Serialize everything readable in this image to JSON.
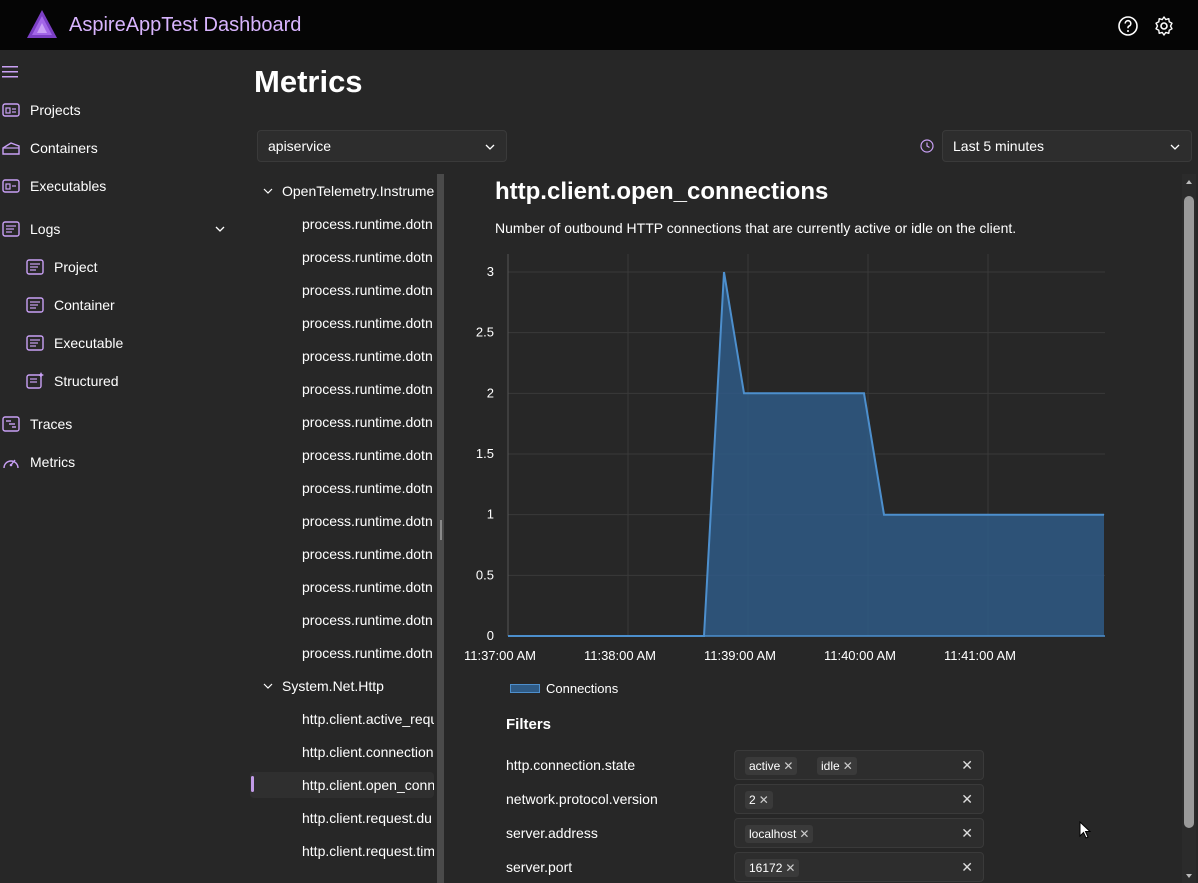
{
  "app": {
    "title": "AspireAppTest Dashboard",
    "accent": "#a366e8"
  },
  "topbar_icons": [
    "help-icon",
    "settings-icon"
  ],
  "sidebar": {
    "items": [
      {
        "label": "Projects",
        "icon": "projects-icon"
      },
      {
        "label": "Containers",
        "icon": "containers-icon"
      },
      {
        "label": "Executables",
        "icon": "executables-icon"
      },
      {
        "label": "Logs",
        "icon": "logs-icon"
      },
      {
        "label": "Project",
        "icon": "log-project-icon"
      },
      {
        "label": "Container",
        "icon": "log-container-icon"
      },
      {
        "label": "Executable",
        "icon": "log-executable-icon"
      },
      {
        "label": "Structured",
        "icon": "log-structured-icon"
      },
      {
        "label": "Traces",
        "icon": "traces-icon"
      },
      {
        "label": "Metrics",
        "icon": "metrics-icon"
      }
    ]
  },
  "page": {
    "title": "Metrics",
    "resource_select": "apiservice",
    "time_select": "Last 5 minutes"
  },
  "tree": {
    "groups": [
      {
        "name": "OpenTelemetry.Instrume",
        "items": [
          "process.runtime.dotn",
          "process.runtime.dotn",
          "process.runtime.dotn",
          "process.runtime.dotn",
          "process.runtime.dotn",
          "process.runtime.dotn",
          "process.runtime.dotn",
          "process.runtime.dotn",
          "process.runtime.dotn",
          "process.runtime.dotn",
          "process.runtime.dotn",
          "process.runtime.dotn",
          "process.runtime.dotn",
          "process.runtime.dotn"
        ]
      },
      {
        "name": "System.Net.Http",
        "items": [
          "http.client.active_requ",
          "http.client.connection",
          "http.client.open_conn",
          "http.client.request.du",
          "http.client.request.tim"
        ]
      }
    ]
  },
  "metric": {
    "title": "http.client.open_connections",
    "description": "Number of outbound HTTP connections that are currently active or idle on the client."
  },
  "chart_data": {
    "type": "area",
    "x": [
      "11:37:00 AM",
      "11:38:00 AM",
      "11:38:38 AM",
      "11:38:48 AM",
      "11:38:58 AM",
      "11:39:58 AM",
      "11:40:08 AM",
      "11:41:58 AM"
    ],
    "x_ticks": [
      "11:37:00 AM",
      "11:38:00 AM",
      "11:39:00 AM",
      "11:40:00 AM",
      "11:41:00 AM"
    ],
    "series": [
      {
        "name": "Connections",
        "values": [
          0,
          0,
          0,
          3,
          2,
          2,
          1,
          1
        ],
        "color": "#2f5b86"
      }
    ],
    "y_ticks": [
      "0",
      "0.5",
      "1",
      "1.5",
      "2",
      "2.5",
      "3"
    ],
    "ylim": [
      0,
      3
    ],
    "grid": true,
    "legend": "bottom-left"
  },
  "filters": {
    "title": "Filters",
    "rows": [
      {
        "label": "http.connection.state",
        "chips": [
          "active",
          "idle"
        ]
      },
      {
        "label": "network.protocol.version",
        "chips": [
          "2"
        ]
      },
      {
        "label": "server.address",
        "chips": [
          "localhost"
        ]
      },
      {
        "label": "server.port",
        "chips": [
          "16172"
        ]
      }
    ]
  }
}
